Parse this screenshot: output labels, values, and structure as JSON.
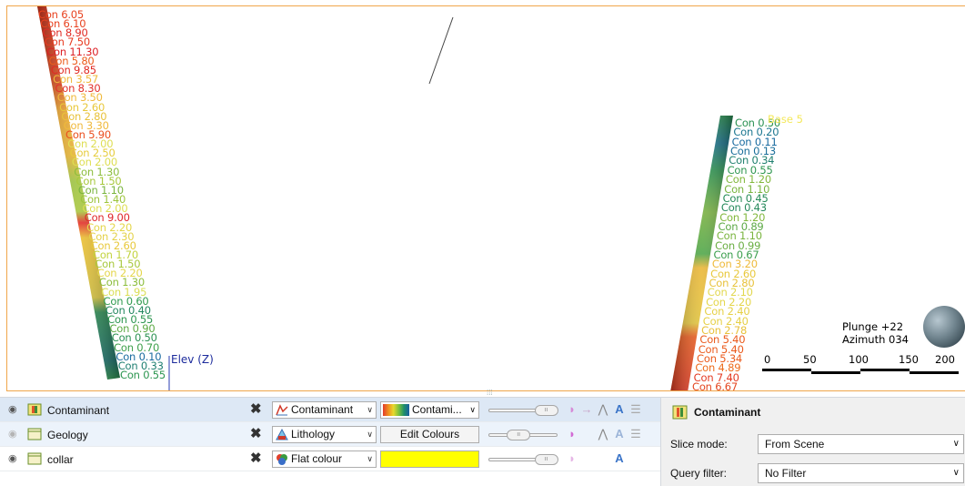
{
  "scene": {
    "left_hole_labels": [
      {
        "text": "Con 6.05",
        "color": "#e8421f"
      },
      {
        "text": "Con 6.10",
        "color": "#e8421f"
      },
      {
        "text": "Con 8.90",
        "color": "#e02a24"
      },
      {
        "text": "Con 7.50",
        "color": "#e83a20"
      },
      {
        "text": "Con 11.30",
        "color": "#dd1f24"
      },
      {
        "text": "Con 5.80",
        "color": "#ec5c1c"
      },
      {
        "text": "Con 9.85",
        "color": "#e12a23"
      },
      {
        "text": "Con 3.57",
        "color": "#f0b93b"
      },
      {
        "text": "Con 8.30",
        "color": "#e2302a"
      },
      {
        "text": "Con 3.50",
        "color": "#f0b93b"
      },
      {
        "text": "Con 2.60",
        "color": "#e8c83b"
      },
      {
        "text": "Con 2.80",
        "color": "#e8c23b"
      },
      {
        "text": "Con 3.30",
        "color": "#f0b93b"
      },
      {
        "text": "Con 5.90",
        "color": "#ea4e1d"
      },
      {
        "text": "Con 2.00",
        "color": "#dede52"
      },
      {
        "text": "Con 2.50",
        "color": "#e6cc3c"
      },
      {
        "text": "Con 2.00",
        "color": "#dede52"
      },
      {
        "text": "Con 1.30",
        "color": "#8cbd3c"
      },
      {
        "text": "Con 1.50",
        "color": "#a7c83c"
      },
      {
        "text": "Con 1.10",
        "color": "#79b43e"
      },
      {
        "text": "Con 1.40",
        "color": "#9cc43c"
      },
      {
        "text": "Con 2.00",
        "color": "#dede52"
      },
      {
        "text": "Con 9.00",
        "color": "#e0262a"
      },
      {
        "text": "Con 2.20",
        "color": "#e4d64a"
      },
      {
        "text": "Con 2.30",
        "color": "#e4d24a"
      },
      {
        "text": "Con 2.60",
        "color": "#e8c83b"
      },
      {
        "text": "Con 1.70",
        "color": "#c2d33e"
      },
      {
        "text": "Con 1.50",
        "color": "#a7c83c"
      },
      {
        "text": "Con 2.20",
        "color": "#e4d64a"
      },
      {
        "text": "Con 1.30",
        "color": "#8cbd3c"
      },
      {
        "text": "Con 1.95",
        "color": "#dbde55"
      },
      {
        "text": "Con 0.60",
        "color": "#2f9a4e"
      },
      {
        "text": "Con 0.40",
        "color": "#23875f"
      },
      {
        "text": "Con 0.55",
        "color": "#2d9650"
      },
      {
        "text": "Con 0.90",
        "color": "#5daa45"
      },
      {
        "text": "Con 0.50",
        "color": "#2a9152"
      },
      {
        "text": "Con 0.70",
        "color": "#3ea04b"
      },
      {
        "text": "Con 0.10",
        "color": "#1a6ba0"
      },
      {
        "text": "Con 0.33",
        "color": "#1f7f71"
      },
      {
        "text": "Con 0.55",
        "color": "#2d9650"
      }
    ],
    "right_hole_labels": [
      {
        "text": "Con 0.50",
        "color": "#2a9152"
      },
      {
        "text": "Con 0.20",
        "color": "#1b7690"
      },
      {
        "text": "Con 0.11",
        "color": "#1a6ba0"
      },
      {
        "text": "Con 0.13",
        "color": "#1a6e9a"
      },
      {
        "text": "Con 0.34",
        "color": "#20806f"
      },
      {
        "text": "Con 0.55",
        "color": "#2d9650"
      },
      {
        "text": "Con 1.20",
        "color": "#82b83d"
      },
      {
        "text": "Con 1.10",
        "color": "#79b43e"
      },
      {
        "text": "Con 0.45",
        "color": "#268b58"
      },
      {
        "text": "Con 0.43",
        "color": "#25895b"
      },
      {
        "text": "Con 1.20",
        "color": "#82b83d"
      },
      {
        "text": "Con 0.89",
        "color": "#5ca946"
      },
      {
        "text": "Con 1.10",
        "color": "#79b43e"
      },
      {
        "text": "Con 0.99",
        "color": "#6aae43"
      },
      {
        "text": "Con 0.67",
        "color": "#3a9e4c"
      },
      {
        "text": "Con 3.20",
        "color": "#eeba3a"
      },
      {
        "text": "Con 2.60",
        "color": "#e8c83b"
      },
      {
        "text": "Con 2.80",
        "color": "#e8c23b"
      },
      {
        "text": "Con 2.10",
        "color": "#e2d850"
      },
      {
        "text": "Con 2.20",
        "color": "#e4d64a"
      },
      {
        "text": "Con 2.40",
        "color": "#e6d046"
      },
      {
        "text": "Con 2.40",
        "color": "#e6d046"
      },
      {
        "text": "Con 2.78",
        "color": "#e8c23b"
      },
      {
        "text": "Con 5.40",
        "color": "#ea5a1c"
      },
      {
        "text": "Con 5.40",
        "color": "#ea5a1c"
      },
      {
        "text": "Con 5.34",
        "color": "#ea5a1c"
      },
      {
        "text": "Con 4.89",
        "color": "#ed6c1c"
      },
      {
        "text": "Con 7.40",
        "color": "#e43a22"
      },
      {
        "text": "Con 6.67",
        "color": "#e4461f"
      }
    ],
    "base_label": "Base 5",
    "axis_label": "Elev (Z)",
    "plunge": "Plunge +22",
    "azimuth": "Azimuth 034",
    "scale_ticks": [
      "0",
      "50",
      "100",
      "150",
      "200"
    ]
  },
  "layers": [
    {
      "name": "Contaminant",
      "style_label": "Contaminant",
      "colour_label": "Contami...",
      "slider_fraction": 0.85,
      "selected": true,
      "visible": true
    },
    {
      "name": "Geology",
      "style_label": "Lithology",
      "colour_label": "Edit Colours",
      "slider_fraction": 0.45,
      "selected": false,
      "visible": false
    },
    {
      "name": "collar",
      "style_label": "Flat colour",
      "colour_hex": "#ffff00",
      "slider_fraction": 0.85,
      "selected": false,
      "visible": true
    }
  ],
  "properties": {
    "title": "Contaminant",
    "slice_mode_label": "Slice mode:",
    "slice_mode_value": "From Scene",
    "query_filter_label": "Query filter:",
    "query_filter_value": "No Filter"
  },
  "icons": {
    "eye": "eye-icon",
    "delete": "delete-x-icon",
    "dropdown": "chevron-down-icon",
    "text": "text-a-icon",
    "lighting": "lightbulb-icon"
  }
}
